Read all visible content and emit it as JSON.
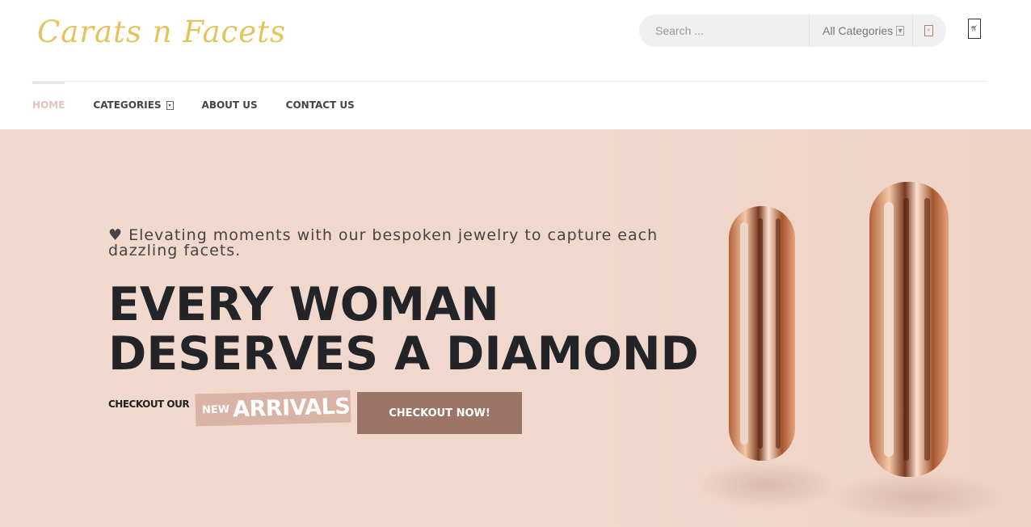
{
  "brand": {
    "name": "Carats n Facets",
    "logo_icon": "diamond-emblem-icon",
    "gold": "#e3c35b",
    "teal": "#1fbfb8"
  },
  "search": {
    "placeholder": "Search ...",
    "category_selected": "All Categories",
    "category_icon": "chevron-down-icon",
    "submit_icon": "search-icon"
  },
  "cart": {
    "icon": "cart-icon"
  },
  "nav": {
    "items": [
      {
        "label": "HOME",
        "active": true
      },
      {
        "label": "CATEGORIES",
        "has_dropdown": true
      },
      {
        "label": "ABOUT US"
      },
      {
        "label": "CONTACT US"
      }
    ]
  },
  "hero": {
    "tagline": "♥ Elevating moments with our bespoken jewelry to capture each dazzling facets.",
    "headline_line1": "EVERY WOMAN",
    "headline_line2": "DESERVES A DIAMOND",
    "checkout_our": "CHECKOUT OUR",
    "badge_new": "NEW",
    "badge_arrivals": "ARRIVALS",
    "cta_label": "CHECKOUT NOW!",
    "image": "rose-gold-rings-image",
    "background_color": "#f2d9cd",
    "accent_color": "#9b7568"
  }
}
